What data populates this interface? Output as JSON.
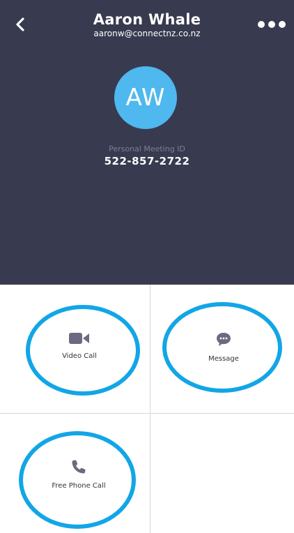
{
  "contact": {
    "name": "Aaron Whale",
    "email": "aaronw@connectnz.co.nz",
    "initials": "AW",
    "meeting_id_label": "Personal Meeting ID",
    "meeting_id": "522-857-2722"
  },
  "actions": {
    "video_call": "Video Call",
    "message": "Message",
    "phone_call": "Free Phone Call"
  },
  "colors": {
    "header_bg": "#383a4f",
    "avatar_bg": "#4fb8ee",
    "icon_gray": "#6b6a80",
    "highlight_ring": "#12a6e6"
  },
  "icons": {
    "back": "chevron-left-icon",
    "more": "more-dots-icon",
    "video": "video-camera-icon",
    "message": "chat-bubble-icon",
    "phone": "phone-icon"
  }
}
